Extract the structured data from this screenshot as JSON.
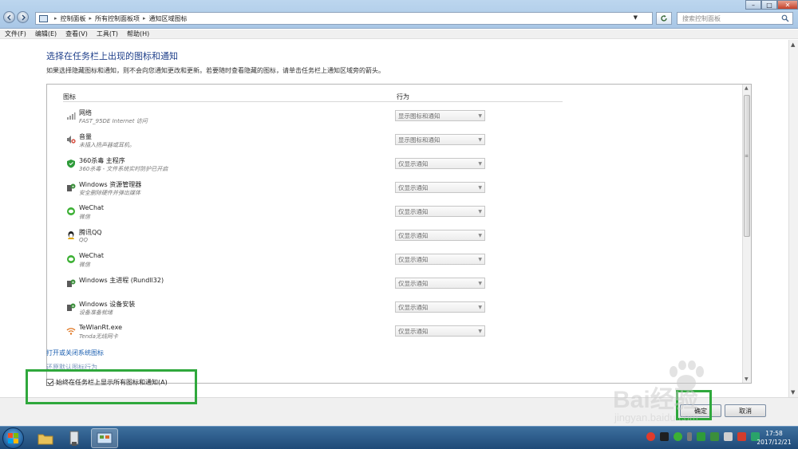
{
  "address_bar": {
    "crumbs": [
      "控制面板",
      "所有控制面板项",
      "通知区域图标"
    ],
    "search_placeholder": "搜索控制面板"
  },
  "menu": {
    "items": [
      "文件(F)",
      "编辑(E)",
      "查看(V)",
      "工具(T)",
      "帮助(H)"
    ]
  },
  "main": {
    "title": "选择在任务栏上出现的图标和通知",
    "description": "如果选择隐藏图标和通知，则不会向您通知更改和更新。若要随时查看隐藏的图标，请单击任务栏上通知区域旁的箭头。",
    "table": {
      "col_icon": "图标",
      "col_behavior": "行为",
      "rows": [
        {
          "name": "网络",
          "desc": "FAST_95DE Internet 访问",
          "behavior": "显示图标和通知",
          "icon": "network-icon",
          "color": "#9a9a9a"
        },
        {
          "name": "音量",
          "desc": "未插入扬声器或耳机。",
          "behavior": "显示图标和通知",
          "icon": "volume-muted-icon",
          "color": "#d23c2c"
        },
        {
          "name": "360杀毒 主程序",
          "desc": "360杀毒 - 文件系统实时防护已开启",
          "behavior": "仅显示通知",
          "icon": "shield-icon",
          "color": "#2e9b3a"
        },
        {
          "name": "Windows 资源管理器",
          "desc": "安全删除硬件并弹出媒体",
          "behavior": "仅显示通知",
          "icon": "usb-eject-icon",
          "color": "#3b8f3b"
        },
        {
          "name": "WeChat",
          "desc": "微信",
          "behavior": "仅显示通知",
          "icon": "wechat-icon",
          "color": "#3cb034"
        },
        {
          "name": "腾讯QQ",
          "desc": "QQ",
          "behavior": "仅显示通知",
          "icon": "qq-penguin-icon",
          "color": "#222222"
        },
        {
          "name": "WeChat",
          "desc": "微信",
          "behavior": "仅显示通知",
          "icon": "wechat-icon",
          "color": "#3cb034"
        },
        {
          "name": "Windows 主进程 (Rundll32)",
          "desc": "",
          "behavior": "仅显示通知",
          "icon": "usb-eject-icon",
          "color": "#3b8f3b"
        },
        {
          "name": "Windows 设备安装",
          "desc": "设备准备就绪",
          "behavior": "仅显示通知",
          "icon": "usb-eject-icon",
          "color": "#3b8f3b"
        },
        {
          "name": "TeWlanRt.exe",
          "desc": "Tenda无线网卡",
          "behavior": "仅显示通知",
          "icon": "wifi-icon",
          "color": "#e0741e"
        }
      ]
    },
    "link_system_icons": "打开或关闭系统图标",
    "link_restore": "还原默认图标行为",
    "checkbox_label": "始终在任务栏上显示所有图标和通知(A)",
    "checkbox_checked": true
  },
  "buttons": {
    "ok": "确定",
    "cancel": "取消"
  },
  "watermark": {
    "brand": "Bai",
    "brand_cn": "经验",
    "url": "jingyan.baidu.com"
  },
  "taskbar": {
    "time": "17:58",
    "date": "2017/12/21"
  }
}
